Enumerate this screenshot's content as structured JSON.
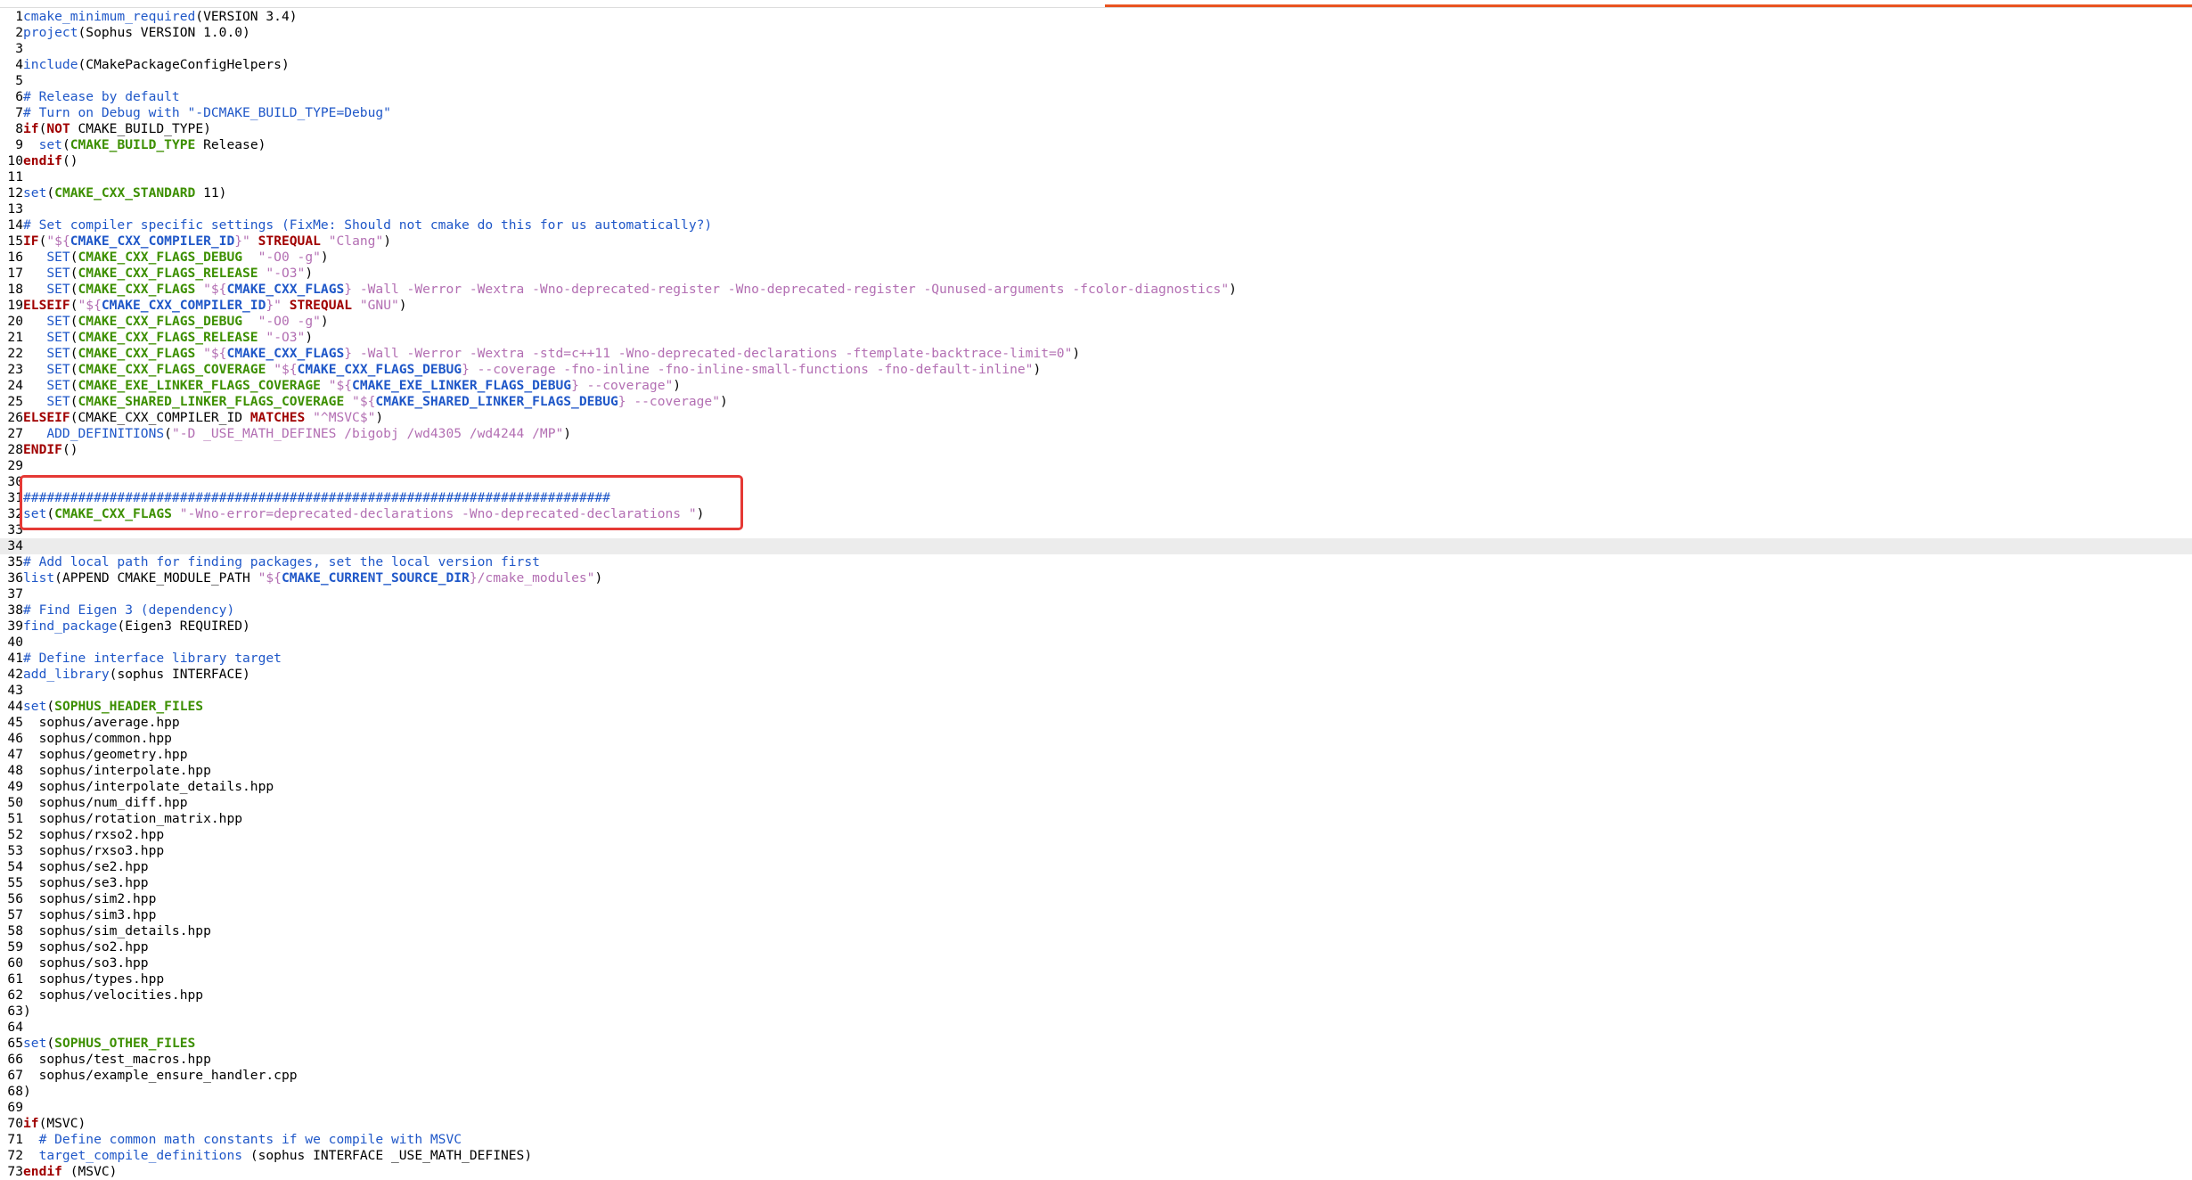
{
  "editor": {
    "current_line": 34,
    "highlight_lines": [
      31,
      32
    ],
    "colors": {
      "progress": "#e95420",
      "highlight": "#e53935"
    },
    "lines": [
      {
        "n": "1",
        "t": [
          [
            "kw",
            "cmake_minimum_required"
          ],
          [
            "",
            "(VERSION 3.4)"
          ]
        ]
      },
      {
        "n": "2",
        "t": [
          [
            "kw",
            "project"
          ],
          [
            "",
            "(Sophus VERSION 1.0.0)"
          ]
        ]
      },
      {
        "n": "3",
        "t": []
      },
      {
        "n": "4",
        "t": [
          [
            "kw",
            "include"
          ],
          [
            "",
            "(CMakePackageConfigHelpers)"
          ]
        ]
      },
      {
        "n": "5",
        "t": []
      },
      {
        "n": "6",
        "t": [
          [
            "comment",
            "# Release by default"
          ]
        ]
      },
      {
        "n": "7",
        "t": [
          [
            "comment",
            "# Turn on Debug with \"-DCMAKE_BUILD_TYPE=Debug\""
          ]
        ]
      },
      {
        "n": "8",
        "t": [
          [
            "kwc",
            "if"
          ],
          [
            "",
            "("
          ],
          [
            "kwc",
            "NOT"
          ],
          [
            "",
            " CMAKE_BUILD_TYPE)"
          ]
        ]
      },
      {
        "n": "9",
        "t": [
          [
            "",
            "  "
          ],
          [
            "kw",
            "set"
          ],
          [
            "",
            "("
          ],
          [
            "var",
            "CMAKE_BUILD_TYPE"
          ],
          [
            "",
            " Release)"
          ]
        ]
      },
      {
        "n": "10",
        "t": [
          [
            "kwc",
            "endif"
          ],
          [
            "",
            "()"
          ]
        ]
      },
      {
        "n": "11",
        "t": []
      },
      {
        "n": "12",
        "t": [
          [
            "kw",
            "set"
          ],
          [
            "",
            "("
          ],
          [
            "var",
            "CMAKE_CXX_STANDARD"
          ],
          [
            "",
            " 11)"
          ]
        ]
      },
      {
        "n": "13",
        "t": []
      },
      {
        "n": "14",
        "t": [
          [
            "comment",
            "# Set compiler specific settings (FixMe: Should not cmake do this for us automatically?)"
          ]
        ]
      },
      {
        "n": "15",
        "t": [
          [
            "kwc",
            "IF"
          ],
          [
            "",
            "("
          ],
          [
            "str",
            "\"${"
          ],
          [
            "varb",
            "CMAKE_CXX_COMPILER_ID"
          ],
          [
            "str",
            "}\""
          ],
          [
            "",
            " "
          ],
          [
            "kwc",
            "STREQUAL"
          ],
          [
            "",
            " "
          ],
          [
            "str",
            "\"Clang\""
          ],
          [
            "",
            ")"
          ]
        ]
      },
      {
        "n": "16",
        "t": [
          [
            "",
            "   "
          ],
          [
            "kw",
            "SET"
          ],
          [
            "",
            "("
          ],
          [
            "var",
            "CMAKE_CXX_FLAGS_DEBUG"
          ],
          [
            "",
            "  "
          ],
          [
            "str",
            "\"-O0 -g\""
          ],
          [
            "",
            ")"
          ]
        ]
      },
      {
        "n": "17",
        "t": [
          [
            "",
            "   "
          ],
          [
            "kw",
            "SET"
          ],
          [
            "",
            "("
          ],
          [
            "var",
            "CMAKE_CXX_FLAGS_RELEASE"
          ],
          [
            "",
            " "
          ],
          [
            "str",
            "\"-O3\""
          ],
          [
            "",
            ")"
          ]
        ]
      },
      {
        "n": "18",
        "t": [
          [
            "",
            "   "
          ],
          [
            "kw",
            "SET"
          ],
          [
            "",
            "("
          ],
          [
            "var",
            "CMAKE_CXX_FLAGS"
          ],
          [
            "",
            " "
          ],
          [
            "str",
            "\"${"
          ],
          [
            "varb",
            "CMAKE_CXX_FLAGS"
          ],
          [
            "str",
            "} -Wall -Werror -Wextra -Wno-deprecated-register -Wno-deprecated-register -Qunused-arguments -fcolor-diagnostics\""
          ],
          [
            "",
            ")"
          ]
        ]
      },
      {
        "n": "19",
        "t": [
          [
            "kwc",
            "ELSEIF"
          ],
          [
            "",
            "("
          ],
          [
            "str",
            "\"${"
          ],
          [
            "varb",
            "CMAKE_CXX_COMPILER_ID"
          ],
          [
            "str",
            "}\""
          ],
          [
            "",
            " "
          ],
          [
            "kwc",
            "STREQUAL"
          ],
          [
            "",
            " "
          ],
          [
            "str",
            "\"GNU\""
          ],
          [
            "",
            ")"
          ]
        ]
      },
      {
        "n": "20",
        "t": [
          [
            "",
            "   "
          ],
          [
            "kw",
            "SET"
          ],
          [
            "",
            "("
          ],
          [
            "var",
            "CMAKE_CXX_FLAGS_DEBUG"
          ],
          [
            "",
            "  "
          ],
          [
            "str",
            "\"-O0 -g\""
          ],
          [
            "",
            ")"
          ]
        ]
      },
      {
        "n": "21",
        "t": [
          [
            "",
            "   "
          ],
          [
            "kw",
            "SET"
          ],
          [
            "",
            "("
          ],
          [
            "var",
            "CMAKE_CXX_FLAGS_RELEASE"
          ],
          [
            "",
            " "
          ],
          [
            "str",
            "\"-O3\""
          ],
          [
            "",
            ")"
          ]
        ]
      },
      {
        "n": "22",
        "t": [
          [
            "",
            "   "
          ],
          [
            "kw",
            "SET"
          ],
          [
            "",
            "("
          ],
          [
            "var",
            "CMAKE_CXX_FLAGS"
          ],
          [
            "",
            " "
          ],
          [
            "str",
            "\"${"
          ],
          [
            "varb",
            "CMAKE_CXX_FLAGS"
          ],
          [
            "str",
            "} -Wall -Werror -Wextra -std=c++11 -Wno-deprecated-declarations -ftemplate-backtrace-limit=0\""
          ],
          [
            "",
            ")"
          ]
        ]
      },
      {
        "n": "23",
        "t": [
          [
            "",
            "   "
          ],
          [
            "kw",
            "SET"
          ],
          [
            "",
            "("
          ],
          [
            "var",
            "CMAKE_CXX_FLAGS_COVERAGE"
          ],
          [
            "",
            " "
          ],
          [
            "str",
            "\"${"
          ],
          [
            "varb",
            "CMAKE_CXX_FLAGS_DEBUG"
          ],
          [
            "str",
            "} --coverage -fno-inline -fno-inline-small-functions -fno-default-inline\""
          ],
          [
            "",
            ")"
          ]
        ]
      },
      {
        "n": "24",
        "t": [
          [
            "",
            "   "
          ],
          [
            "kw",
            "SET"
          ],
          [
            "",
            "("
          ],
          [
            "var",
            "CMAKE_EXE_LINKER_FLAGS_COVERAGE"
          ],
          [
            "",
            " "
          ],
          [
            "str",
            "\"${"
          ],
          [
            "varb",
            "CMAKE_EXE_LINKER_FLAGS_DEBUG"
          ],
          [
            "str",
            "} --coverage\""
          ],
          [
            "",
            ")"
          ]
        ]
      },
      {
        "n": "25",
        "t": [
          [
            "",
            "   "
          ],
          [
            "kw",
            "SET"
          ],
          [
            "",
            "("
          ],
          [
            "var",
            "CMAKE_SHARED_LINKER_FLAGS_COVERAGE"
          ],
          [
            "",
            " "
          ],
          [
            "str",
            "\"${"
          ],
          [
            "varb",
            "CMAKE_SHARED_LINKER_FLAGS_DEBUG"
          ],
          [
            "str",
            "} --coverage\""
          ],
          [
            "",
            ")"
          ]
        ]
      },
      {
        "n": "26",
        "t": [
          [
            "kwc",
            "ELSEIF"
          ],
          [
            "",
            "(CMAKE_CXX_COMPILER_ID "
          ],
          [
            "kwc",
            "MATCHES"
          ],
          [
            "",
            " "
          ],
          [
            "str",
            "\"^MSVC$\""
          ],
          [
            "",
            ")"
          ]
        ]
      },
      {
        "n": "27",
        "t": [
          [
            "",
            "   "
          ],
          [
            "kw",
            "ADD_DEFINITIONS"
          ],
          [
            "",
            "("
          ],
          [
            "str",
            "\"-D _USE_MATH_DEFINES /bigobj /wd4305 /wd4244 /MP\""
          ],
          [
            "",
            ")"
          ]
        ]
      },
      {
        "n": "28",
        "t": [
          [
            "kwc",
            "ENDIF"
          ],
          [
            "",
            "()"
          ]
        ]
      },
      {
        "n": "29",
        "t": []
      },
      {
        "n": "30",
        "t": []
      },
      {
        "n": "31",
        "t": [
          [
            "comment",
            "###########################################################################"
          ]
        ]
      },
      {
        "n": "32",
        "t": [
          [
            "kw",
            "set"
          ],
          [
            "",
            "("
          ],
          [
            "var",
            "CMAKE_CXX_FLAGS"
          ],
          [
            "",
            " "
          ],
          [
            "str",
            "\"-Wno-error=deprecated-declarations -Wno-deprecated-declarations \""
          ],
          [
            "",
            ")"
          ]
        ]
      },
      {
        "n": "33",
        "t": []
      },
      {
        "n": "34",
        "t": []
      },
      {
        "n": "35",
        "t": [
          [
            "comment",
            "# Add local path for finding packages, set the local version first"
          ]
        ]
      },
      {
        "n": "36",
        "t": [
          [
            "kw",
            "list"
          ],
          [
            "",
            "(APPEND CMAKE_MODULE_PATH "
          ],
          [
            "str",
            "\"${"
          ],
          [
            "varb",
            "CMAKE_CURRENT_SOURCE_DIR"
          ],
          [
            "str",
            "}/cmake_modules\""
          ],
          [
            "",
            ")"
          ]
        ]
      },
      {
        "n": "37",
        "t": []
      },
      {
        "n": "38",
        "t": [
          [
            "comment",
            "# Find Eigen 3 (dependency)"
          ]
        ]
      },
      {
        "n": "39",
        "t": [
          [
            "kw",
            "find_package"
          ],
          [
            "",
            "(Eigen3 REQUIRED)"
          ]
        ]
      },
      {
        "n": "40",
        "t": []
      },
      {
        "n": "41",
        "t": [
          [
            "comment",
            "# Define interface library target"
          ]
        ]
      },
      {
        "n": "42",
        "t": [
          [
            "kw",
            "add_library"
          ],
          [
            "",
            "(sophus INTERFACE)"
          ]
        ]
      },
      {
        "n": "43",
        "t": []
      },
      {
        "n": "44",
        "t": [
          [
            "kw",
            "set"
          ],
          [
            "",
            "("
          ],
          [
            "var",
            "SOPHUS_HEADER_FILES"
          ]
        ]
      },
      {
        "n": "45",
        "t": [
          [
            "",
            "  sophus/average.hpp"
          ]
        ]
      },
      {
        "n": "46",
        "t": [
          [
            "",
            "  sophus/common.hpp"
          ]
        ]
      },
      {
        "n": "47",
        "t": [
          [
            "",
            "  sophus/geometry.hpp"
          ]
        ]
      },
      {
        "n": "48",
        "t": [
          [
            "",
            "  sophus/interpolate.hpp"
          ]
        ]
      },
      {
        "n": "49",
        "t": [
          [
            "",
            "  sophus/interpolate_details.hpp"
          ]
        ]
      },
      {
        "n": "50",
        "t": [
          [
            "",
            "  sophus/num_diff.hpp"
          ]
        ]
      },
      {
        "n": "51",
        "t": [
          [
            "",
            "  sophus/rotation_matrix.hpp"
          ]
        ]
      },
      {
        "n": "52",
        "t": [
          [
            "",
            "  sophus/rxso2.hpp"
          ]
        ]
      },
      {
        "n": "53",
        "t": [
          [
            "",
            "  sophus/rxso3.hpp"
          ]
        ]
      },
      {
        "n": "54",
        "t": [
          [
            "",
            "  sophus/se2.hpp"
          ]
        ]
      },
      {
        "n": "55",
        "t": [
          [
            "",
            "  sophus/se3.hpp"
          ]
        ]
      },
      {
        "n": "56",
        "t": [
          [
            "",
            "  sophus/sim2.hpp"
          ]
        ]
      },
      {
        "n": "57",
        "t": [
          [
            "",
            "  sophus/sim3.hpp"
          ]
        ]
      },
      {
        "n": "58",
        "t": [
          [
            "",
            "  sophus/sim_details.hpp"
          ]
        ]
      },
      {
        "n": "59",
        "t": [
          [
            "",
            "  sophus/so2.hpp"
          ]
        ]
      },
      {
        "n": "60",
        "t": [
          [
            "",
            "  sophus/so3.hpp"
          ]
        ]
      },
      {
        "n": "61",
        "t": [
          [
            "",
            "  sophus/types.hpp"
          ]
        ]
      },
      {
        "n": "62",
        "t": [
          [
            "",
            "  sophus/velocities.hpp"
          ]
        ]
      },
      {
        "n": "63",
        "t": [
          [
            "",
            ")"
          ]
        ]
      },
      {
        "n": "64",
        "t": []
      },
      {
        "n": "65",
        "t": [
          [
            "kw",
            "set"
          ],
          [
            "",
            "("
          ],
          [
            "var",
            "SOPHUS_OTHER_FILES"
          ]
        ]
      },
      {
        "n": "66",
        "t": [
          [
            "",
            "  sophus/test_macros.hpp"
          ]
        ]
      },
      {
        "n": "67",
        "t": [
          [
            "",
            "  sophus/example_ensure_handler.cpp"
          ]
        ]
      },
      {
        "n": "68",
        "t": [
          [
            "",
            ")"
          ]
        ]
      },
      {
        "n": "69",
        "t": []
      },
      {
        "n": "70",
        "t": [
          [
            "kwc",
            "if"
          ],
          [
            "",
            "(MSVC)"
          ]
        ]
      },
      {
        "n": "71",
        "t": [
          [
            "",
            "  "
          ],
          [
            "comment",
            "# Define common math constants if we compile with MSVC"
          ]
        ]
      },
      {
        "n": "72",
        "t": [
          [
            "",
            "  "
          ],
          [
            "kw",
            "target_compile_definitions"
          ],
          [
            "",
            " (sophus INTERFACE _USE_MATH_DEFINES)"
          ]
        ]
      },
      {
        "n": "73",
        "t": [
          [
            "kwc",
            "endif"
          ],
          [
            "",
            " (MSVC)"
          ]
        ]
      }
    ]
  }
}
